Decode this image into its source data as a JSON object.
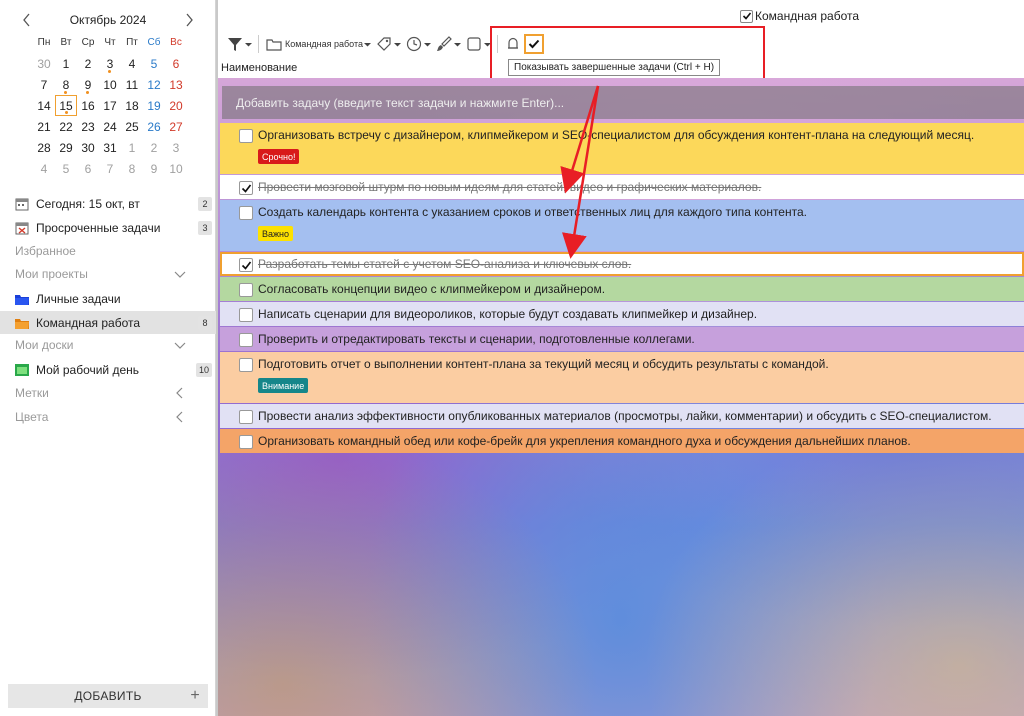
{
  "calendar": {
    "title": "Октябрь 2024",
    "weekdays": [
      "Пн",
      "Вт",
      "Ср",
      "Чт",
      "Пт",
      "Сб",
      "Вс"
    ],
    "days": [
      {
        "d": "30",
        "muted": true
      },
      {
        "d": "1"
      },
      {
        "d": "2"
      },
      {
        "d": "3",
        "dot": true
      },
      {
        "d": "4"
      },
      {
        "d": "5",
        "sat": true
      },
      {
        "d": "6",
        "sun": true
      },
      {
        "d": "7"
      },
      {
        "d": "8",
        "dot": true
      },
      {
        "d": "9",
        "dot": true
      },
      {
        "d": "10"
      },
      {
        "d": "11"
      },
      {
        "d": "12",
        "sat": true
      },
      {
        "d": "13",
        "sun": true
      },
      {
        "d": "14"
      },
      {
        "d": "15",
        "today": true,
        "dot": true
      },
      {
        "d": "16"
      },
      {
        "d": "17"
      },
      {
        "d": "18"
      },
      {
        "d": "19",
        "sat": true
      },
      {
        "d": "20",
        "sun": true
      },
      {
        "d": "21"
      },
      {
        "d": "22"
      },
      {
        "d": "23"
      },
      {
        "d": "24"
      },
      {
        "d": "25"
      },
      {
        "d": "26",
        "sat": true
      },
      {
        "d": "27",
        "sun": true
      },
      {
        "d": "28"
      },
      {
        "d": "29"
      },
      {
        "d": "30"
      },
      {
        "d": "31"
      },
      {
        "d": "1",
        "muted": true
      },
      {
        "d": "2",
        "muted": true
      },
      {
        "d": "3",
        "muted": true
      },
      {
        "d": "4",
        "muted": true
      },
      {
        "d": "5",
        "muted": true
      },
      {
        "d": "6",
        "muted": true
      },
      {
        "d": "7",
        "muted": true
      },
      {
        "d": "8",
        "muted": true
      },
      {
        "d": "9",
        "muted": true
      },
      {
        "d": "10",
        "muted": true
      }
    ]
  },
  "sidebar": {
    "today": {
      "label": "Сегодня: 15 окт, вт",
      "count": "2",
      "icon": "calendar-icon"
    },
    "overdue": {
      "label": "Просроченные задачи",
      "count": "3",
      "icon": "overdue-calendar-icon"
    },
    "favorites": "Избранное",
    "my_projects": "Мои проекты",
    "personal": {
      "label": "Личные задачи",
      "icon": "folder-blue-icon"
    },
    "team": {
      "label": "Командная работа",
      "count": "8",
      "icon": "folder-orange-icon"
    },
    "my_boards": "Мои доски",
    "workday": {
      "label": "Мой рабочий день",
      "count": "10",
      "icon": "board-green-icon"
    },
    "tags": "Метки",
    "colors": "Цвета",
    "add_button": "ДОБАВИТЬ",
    "add_plus": "+"
  },
  "header": {
    "team_checkbox_label": "Командная работа",
    "project_dropdown": "Командная работа",
    "column_name": "Наименование",
    "tooltip": "Показывать завершенные задачи (Ctrl + H)"
  },
  "add_task_placeholder": "Добавить задачу (введите текст задачи и нажмите Enter)...",
  "tasks": [
    {
      "text": "Организовать встречу с дизайнером, клипмейкером и SEO-специалистом для обсуждения контент-плана на следующий месяц.",
      "done": false,
      "color": "#fcd85a",
      "badge": "Срочно!",
      "badge_bg": "#d81a1a",
      "badge_fg": "#ffffff"
    },
    {
      "text": "Провести мозговой штурм по новым идеям для статей, видео и графических материалов.",
      "done": true,
      "color": "#ffffff"
    },
    {
      "text": "Создать календарь контента с указанием сроков и ответственных лиц для каждого типа контента.",
      "done": false,
      "color": "#a4bff0",
      "badge": "Важно",
      "badge_bg": "#fde100",
      "badge_fg": "#222222"
    },
    {
      "text": "Разработать темы статей с учетом SEO-анализа и ключевых слов.",
      "done": true,
      "color": "#ffffff",
      "selected": true
    },
    {
      "text": "Согласовать концепции видео с клипмейкером и дизайнером.",
      "done": false,
      "color": "#b4d8a0"
    },
    {
      "text": "Написать сценарии для видеороликов, которые будут создавать клипмейкер и дизайнер.",
      "done": false,
      "color": "#e1e1f4"
    },
    {
      "text": "Проверить и отредактировать тексты и сценарии, подготовленные коллегами.",
      "done": false,
      "color": "#c6a0dc"
    },
    {
      "text": "Подготовить отчет о выполнении контент-плана за текущий месяц и обсудить результаты с командой.",
      "done": false,
      "color": "#fbcda2",
      "badge": "Внимание",
      "badge_bg": "#15868a",
      "badge_fg": "#ffffff"
    },
    {
      "text": "Провести анализ эффективности опубликованных материалов (просмотры, лайки, комментарии) и обсудить с SEO-специалистом.",
      "done": false,
      "color": "#e1e1f4"
    },
    {
      "text": "Организовать командный обед или кофе-брейк для укрепления командного духа и обсуждения дальнейших планов.",
      "done": false,
      "color": "#f4a468"
    }
  ],
  "colors": {
    "accent_orange": "#f0a030",
    "annotation_red": "#e81e25"
  }
}
